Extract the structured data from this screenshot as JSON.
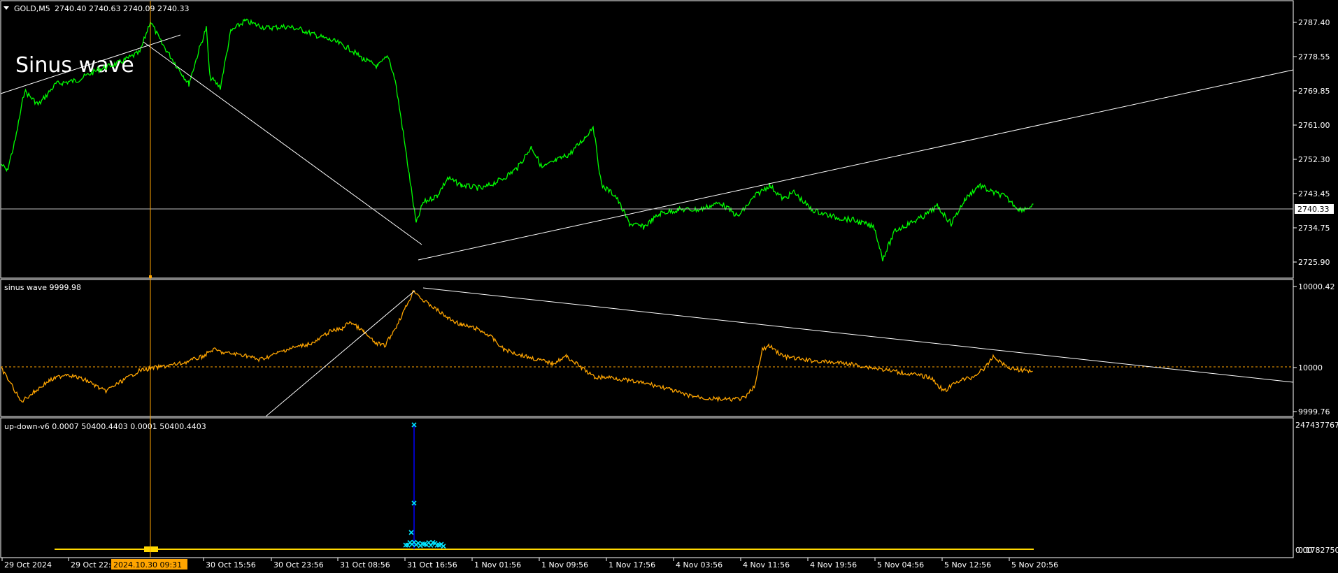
{
  "main_panel": {
    "symbol": "GOLD,M5",
    "ohlc": "2740.40 2740.63 2740.09 2740.33",
    "annotation": "Sinus wave",
    "price_ticks": [
      "2787.40",
      "2778.55",
      "2769.85",
      "2761.00",
      "2752.30",
      "2743.45",
      "2734.75",
      "2725.90"
    ],
    "current_price": "2740.33"
  },
  "indicator_panel_1": {
    "label": "sinus wave 9999.98",
    "ticks": [
      "10000.42",
      "10000",
      "9999.76"
    ]
  },
  "indicator_panel_2": {
    "label": "up-down-v6 0.0007 50400.4403 0.0001 50400.4403",
    "ticks": [
      "247437767",
      "0.00",
      "0.1782750"
    ]
  },
  "time_axis": {
    "labels": [
      "29 Oct 2024",
      "29 Oct 22:",
      "30 Oct 15:56",
      "30 Oct 23:56",
      "31 Oct 08:56",
      "31 Oct 16:56",
      "1 Nov 01:56",
      "1 Nov 09:56",
      "1 Nov 17:56",
      "4 Nov 03:56",
      "4 Nov 11:56",
      "4 Nov 19:56",
      "5 Nov 04:56",
      "5 Nov 12:56",
      "5 Nov 20:56"
    ],
    "crosshair_time": "2024.10.30 09:31"
  },
  "colors": {
    "background": "#000000",
    "price_line": "#00ff00",
    "sinus_line": "#ffa500",
    "updown_marker": "#00e5ff",
    "updown_bar": "#0000ff",
    "updown_base": "#ffd700",
    "crosshair": "#ffa500",
    "grid_text": "#ffffff"
  }
}
